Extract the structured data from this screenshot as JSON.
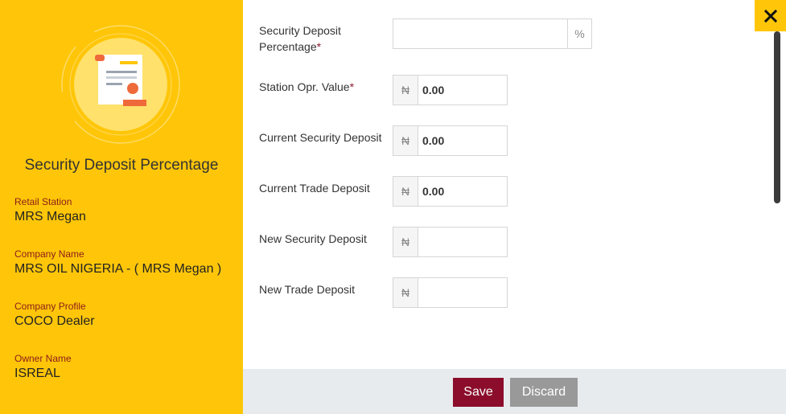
{
  "sidebar": {
    "title": "Security Deposit Percentage",
    "fields": [
      {
        "label": "Retail Station",
        "value": "MRS Megan"
      },
      {
        "label": "Company Name",
        "value": "MRS OIL NIGERIA - ( MRS Megan )"
      },
      {
        "label": "Company Profile",
        "value": "COCO Dealer"
      },
      {
        "label": "Owner Name",
        "value": "ISREAL"
      }
    ]
  },
  "form": {
    "security_deposit_percentage": {
      "label_line1": "Security Deposit",
      "label_line2": "Percentage",
      "required_mark": "*",
      "value": "",
      "addon": "%"
    },
    "station_opr_value": {
      "label": "Station Opr. Value",
      "required_mark": "*",
      "addon": "₦",
      "value": "0.00"
    },
    "current_security_deposit": {
      "label": "Current Security Deposit",
      "addon": "₦",
      "value": "0.00"
    },
    "current_trade_deposit": {
      "label": "Current Trade Deposit",
      "addon": "₦",
      "value": "0.00"
    },
    "new_security_deposit": {
      "label": "New Security Deposit",
      "addon": "₦",
      "value": ""
    },
    "new_trade_deposit": {
      "label": "New Trade Deposit",
      "addon": "₦",
      "value": ""
    }
  },
  "footer": {
    "save_label": "Save",
    "discard_label": "Discard"
  },
  "icons": {
    "close": "close-icon",
    "illustration": "certificate-scroll-icon"
  },
  "colors": {
    "panel": "#ffc609",
    "accent": "#8b0d2b",
    "discard": "#999999",
    "footer": "#e8ebee"
  }
}
